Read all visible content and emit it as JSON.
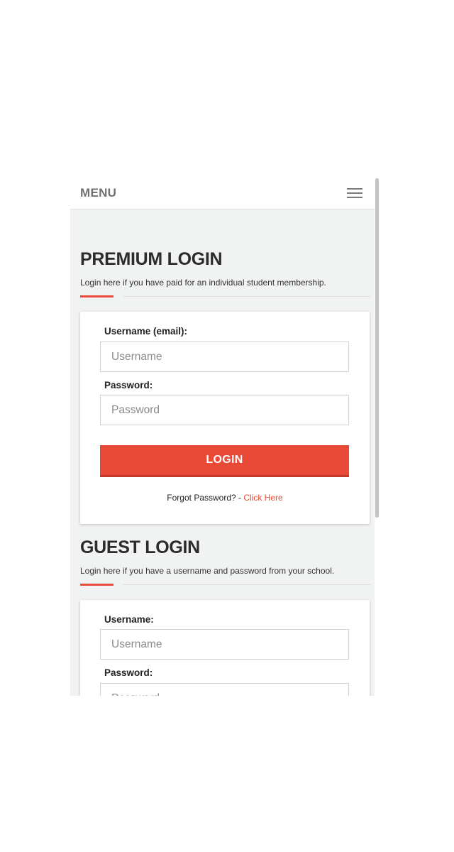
{
  "navbar": {
    "menu_label": "MENU",
    "menu_icon": "hamburger-icon"
  },
  "premium": {
    "title": "PREMIUM LOGIN",
    "description": "Login here if you have paid for an individual student membership.",
    "username_label": "Username (email):",
    "username_placeholder": "Username",
    "password_label": "Password:",
    "password_placeholder": "Password",
    "login_button": "LOGIN",
    "forgot_text": "Forgot Password? - ",
    "forgot_link": "Click Here"
  },
  "guest": {
    "title": "GUEST LOGIN",
    "description": "Login here if you have a username and password from your school.",
    "username_label": "Username:",
    "username_placeholder": "Username",
    "password_label": "Password:",
    "password_placeholder": "Password"
  },
  "colors": {
    "accent": "#e84a37",
    "background": "#f1f2f2",
    "heading": "#2b2b2b"
  }
}
